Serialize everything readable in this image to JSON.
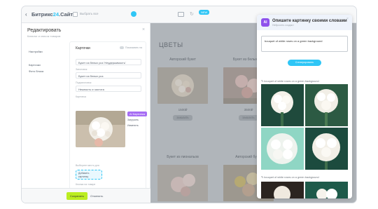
{
  "topbar": {
    "back": "‹",
    "brand_prefix": "Битрикс",
    "brand_num": "24",
    "brand_suffix": ".Сайты",
    "checkbox_label": "Выбрать все",
    "pill": "NEW"
  },
  "editor": {
    "title": "Редактировать",
    "subtitle": "Каталог и список товаров",
    "nav": [
      "Настройки",
      "Карточки",
      "Фото блока"
    ],
    "card": {
      "title": "Карточки",
      "toggle_label": "Показывать на",
      "fields": [
        {
          "label": "",
          "value": "Букет из белых роз 'Неудержимость'"
        },
        {
          "label": "Заголовок",
          "value": "Букет из белых роз"
        },
        {
          "label": "Подзаголовок",
          "value": "Нежность и чистота"
        },
        {
          "label": "Картинка",
          "value": ""
        }
      ],
      "ai_button": "AI Картинка",
      "side_links": [
        "Загрузить",
        "Изменить"
      ],
      "slot_label": "Выберите место для",
      "slot_lines": [
        "Добавить",
        "картинку"
      ],
      "more_fields": [
        {
          "label": "Кнопка на товаре",
          "value": "Купить"
        },
        {
          "label": "Цена",
          "value": ""
        }
      ]
    },
    "footer": {
      "save": "Сохранить",
      "cancel": "Отменить"
    }
  },
  "catalog": {
    "heading": "ЦВЕТЫ",
    "products": [
      {
        "name": "Авторский букет",
        "price": "",
        "button": ""
      },
      {
        "name": "Букет из белых роз",
        "price": "",
        "button": ""
      },
      {
        "name": "",
        "price": "1500₽",
        "button": "ЗАКАЗАТЬ"
      },
      {
        "name": "",
        "price": "3500₽",
        "button": "ЗАКАЗАТЬ"
      },
      {
        "name": "Букет из пиональов",
        "price": "",
        "button": ""
      },
      {
        "name": "Авторский букет",
        "price": "",
        "button": ""
      }
    ]
  },
  "panel": {
    "logo": "AI",
    "title": "Опишите картинку своими словами",
    "subtitle": "Нейросеть создаст",
    "prompt_value": "bouquet of white roses on a green background",
    "generate": "Сгенерировать",
    "result_label": "bouquet of white roses on a green background",
    "result_label_2": "bouquet of white roses on a green background",
    "colors": {
      "accent": "#2fc6f6",
      "ai": "#8e52ec",
      "dark_green": "#1f4a3c",
      "teal": "#8fd6c4"
    }
  }
}
